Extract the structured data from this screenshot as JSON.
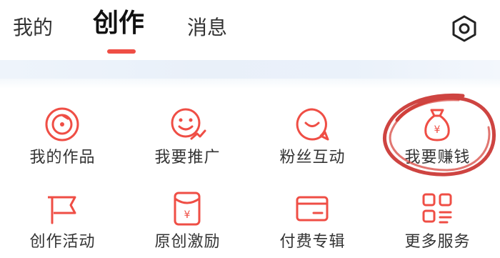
{
  "tabs": [
    {
      "label": "我的"
    },
    {
      "label": "创作"
    },
    {
      "label": "消息"
    }
  ],
  "accent_color": "#ef4e45",
  "settings_icon": "gear-icon",
  "grid": {
    "items": [
      {
        "label": "我的作品",
        "icon": "disc-icon"
      },
      {
        "label": "我要推广",
        "icon": "smile-promote-icon"
      },
      {
        "label": "粉丝互动",
        "icon": "chat-smile-icon"
      },
      {
        "label": "我要赚钱",
        "icon": "money-bag-icon"
      },
      {
        "label": "创作活动",
        "icon": "flag-icon"
      },
      {
        "label": "原创激励",
        "icon": "red-envelope-icon"
      },
      {
        "label": "付费专辑",
        "icon": "card-icon"
      },
      {
        "label": "更多服务",
        "icon": "grid-apps-icon"
      }
    ]
  }
}
